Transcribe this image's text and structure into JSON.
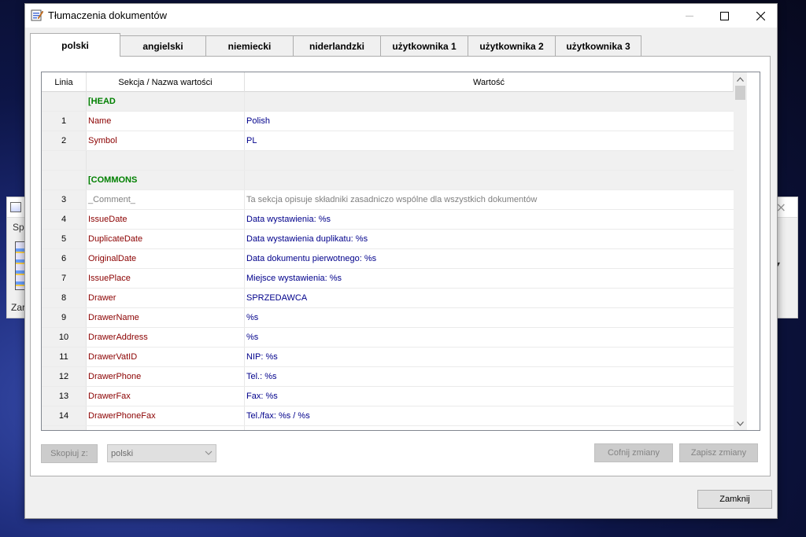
{
  "background_window": {
    "label_sp": "Spr",
    "label_za": "Zar",
    "icon_text": "FA"
  },
  "window": {
    "title": "Tłumaczenia dokumentów",
    "minimize_icon": "minimize-icon",
    "maximize_icon": "maximize-icon",
    "close_icon": "close-icon"
  },
  "tabs": [
    {
      "label": "polski",
      "active": true
    },
    {
      "label": "angielski"
    },
    {
      "label": "niemiecki"
    },
    {
      "label": "niderlandzki"
    },
    {
      "label": "użytkownika 1"
    },
    {
      "label": "użytkownika 2"
    },
    {
      "label": "użytkownika 3"
    }
  ],
  "grid": {
    "columns": [
      "Linia",
      "Sekcja / Nazwa wartości",
      "Wartość"
    ],
    "rows": [
      {
        "type": "section",
        "line": "",
        "name": "[HEAD",
        "value": ""
      },
      {
        "type": "data",
        "line": "1",
        "name": "Name",
        "value": "Polish"
      },
      {
        "type": "data",
        "line": "2",
        "name": "Symbol",
        "value": "PL"
      },
      {
        "type": "blank",
        "line": "",
        "name": "",
        "value": ""
      },
      {
        "type": "section",
        "line": "",
        "name": "[COMMONS",
        "value": ""
      },
      {
        "type": "comment",
        "line": "3",
        "name": "_Comment_",
        "value": "Ta sekcja opisuje składniki zasadniczo wspólne dla wszystkich dokumentów"
      },
      {
        "type": "data",
        "line": "4",
        "name": "IssueDate",
        "value": "Data wystawienia: %s"
      },
      {
        "type": "data",
        "line": "5",
        "name": "DuplicateDate",
        "value": "Data wystawienia duplikatu: %s"
      },
      {
        "type": "data",
        "line": "6",
        "name": "OriginalDate",
        "value": "Data dokumentu pierwotnego: %s"
      },
      {
        "type": "data",
        "line": "7",
        "name": "IssuePlace",
        "value": "Miejsce wystawienia: %s"
      },
      {
        "type": "data",
        "line": "8",
        "name": "Drawer",
        "value": "SPRZEDAWCA"
      },
      {
        "type": "data",
        "line": "9",
        "name": "DrawerName",
        "value": "%s"
      },
      {
        "type": "data",
        "line": "10",
        "name": "DrawerAddress",
        "value": "%s"
      },
      {
        "type": "data",
        "line": "11",
        "name": "DrawerVatID",
        "value": "NIP: %s"
      },
      {
        "type": "data",
        "line": "12",
        "name": "DrawerPhone",
        "value": "Tel.: %s"
      },
      {
        "type": "data",
        "line": "13",
        "name": "DrawerFax",
        "value": "Fax: %s"
      },
      {
        "type": "data",
        "line": "14",
        "name": "DrawerPhoneFax",
        "value": "Tel./fax: %s / %s"
      },
      {
        "type": "data",
        "line": "",
        "name": "",
        "value": ""
      }
    ]
  },
  "controls": {
    "copy_from_label": "Skopiuj z:",
    "copy_from_value": "polski",
    "revert_label": "Cofnij zmiany",
    "save_label": "Zapisz zmiany",
    "close_label": "Zamknij"
  },
  "colors": {
    "section_name": "#008000",
    "key_name": "#8b0000",
    "value_text": "#00008b",
    "comment_text": "#808080"
  }
}
